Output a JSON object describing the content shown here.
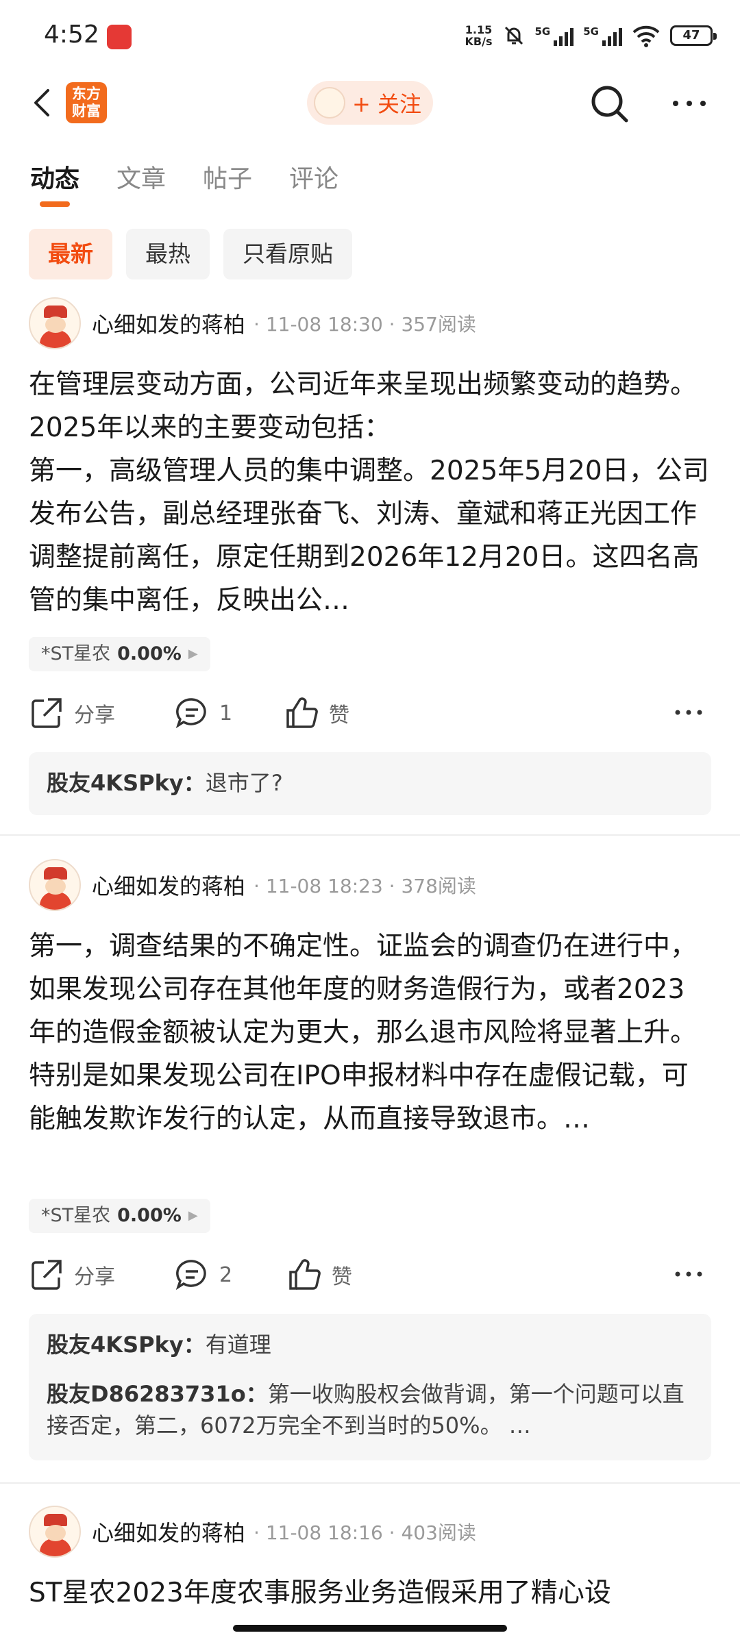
{
  "status_bar": {
    "time": "4:52",
    "net_speed_value": "1.15",
    "net_speed_unit": "KB/s",
    "signal1_label": "5G",
    "signal2_label": "5G",
    "battery": "47",
    "icons": [
      "app-notification-icon",
      "mute-bell-icon",
      "signal-icon",
      "wifi-icon",
      "battery-icon"
    ]
  },
  "header": {
    "logo_line1": "东方",
    "logo_line2": "财富",
    "follow_label": "+ 关注",
    "accent_color": "#f24c11"
  },
  "tabs": [
    {
      "label": "动态",
      "active": true
    },
    {
      "label": "文章",
      "active": false
    },
    {
      "label": "帖子",
      "active": false
    },
    {
      "label": "评论",
      "active": false
    }
  ],
  "filters": [
    {
      "label": "最新",
      "active": true
    },
    {
      "label": "最热",
      "active": false
    },
    {
      "label": "只看原贴",
      "active": false
    }
  ],
  "posts": [
    {
      "author": "心细如发的蒋柏",
      "meta": "· 11-08 18:30 · 357阅读",
      "body": "在管理层变动方面，公司近年来呈现出频繁变动的趋势。2025年以来的主要变动包括：\n第一，高级管理人员的集中调整。2025年5月20日，公司发布公告，副总经理张奋飞、刘涛、童斌和蒋正光因工作调整提前离任，原定任期到2026年12月20日。这四名高管的集中离任，反映出公…",
      "stock_name": "*ST星农",
      "stock_change": "0.00%",
      "share_label": "分享",
      "comment_count": "1",
      "like_label": "赞",
      "comments": [
        {
          "name": "股友4KSPky：",
          "text": "退市了?"
        }
      ]
    },
    {
      "author": "心细如发的蒋柏",
      "meta": "· 11-08 18:23 · 378阅读",
      "body": "第一，调查结果的不确定性。证监会的调查仍在进行中，如果发现公司存在其他年度的财务造假行为，或者2023年的造假金额被认定为更大，那么退市风险将显著上升。特别是如果发现公司在IPO申报材料中存在虚假记载，可能触发欺诈发行的认定，从而直接导致退市。…",
      "stock_name": "*ST星农",
      "stock_change": "0.00%",
      "share_label": "分享",
      "comment_count": "2",
      "like_label": "赞",
      "comments": [
        {
          "name": "股友4KSPky：",
          "text": "有道理"
        },
        {
          "name": "股友D86283731o：",
          "text": "第一收购股权会做背调，第一个问题可以直接否定，第二，6072万完全不到当时的50%。 …"
        }
      ]
    },
    {
      "author": "心细如发的蒋柏",
      "meta": "· 11-08 18:16 · 403阅读",
      "body": "ST星农2023年度农事服务业务造假采用了精心设"
    }
  ]
}
